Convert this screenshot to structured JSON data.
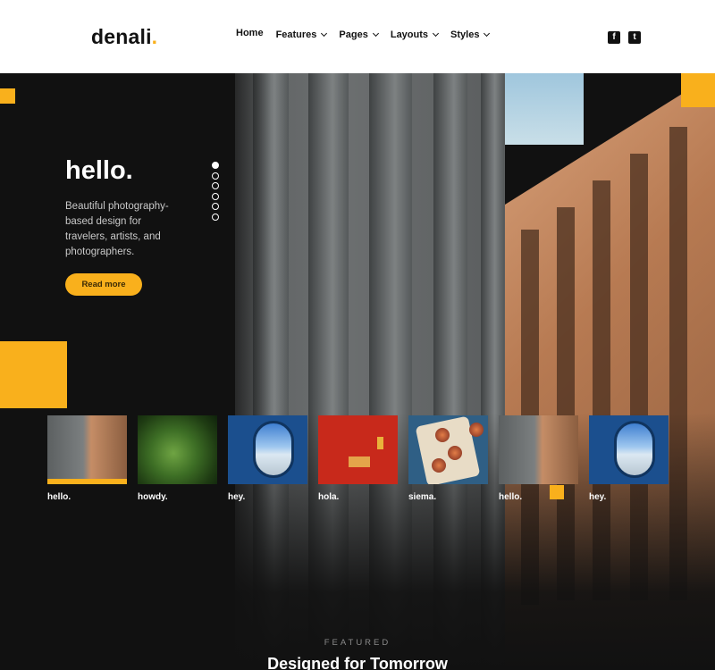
{
  "brand": {
    "name": "denali",
    "dot": ".",
    "accent": "#f9b01c"
  },
  "nav": [
    {
      "label": "Home",
      "dropdown": false
    },
    {
      "label": "Features",
      "dropdown": true
    },
    {
      "label": "Pages",
      "dropdown": true
    },
    {
      "label": "Layouts",
      "dropdown": true
    },
    {
      "label": "Styles",
      "dropdown": true
    }
  ],
  "social": [
    {
      "icon": "facebook-icon",
      "glyph": "f"
    },
    {
      "icon": "twitter-icon",
      "glyph": "t"
    }
  ],
  "hero": {
    "title": "hello.",
    "text": "Beautiful photography-based design for travelers, artists, and photographers.",
    "button": "Read more",
    "slides_count": 6,
    "active_slide": 1
  },
  "thumbnails": [
    {
      "label": "hello.",
      "image": "building",
      "active": true
    },
    {
      "label": "howdy.",
      "image": "moss",
      "active": false
    },
    {
      "label": "hey.",
      "image": "airplane-window",
      "active": false
    },
    {
      "label": "hola.",
      "image": "red-door",
      "active": false
    },
    {
      "label": "siema.",
      "image": "figs",
      "active": false
    },
    {
      "label": "hello.",
      "image": "building",
      "active": false
    },
    {
      "label": "hey.",
      "image": "airplane-window",
      "active": false
    }
  ],
  "featured": {
    "eyebrow": "FEATURED",
    "title": "Designed for Tomorrow"
  }
}
